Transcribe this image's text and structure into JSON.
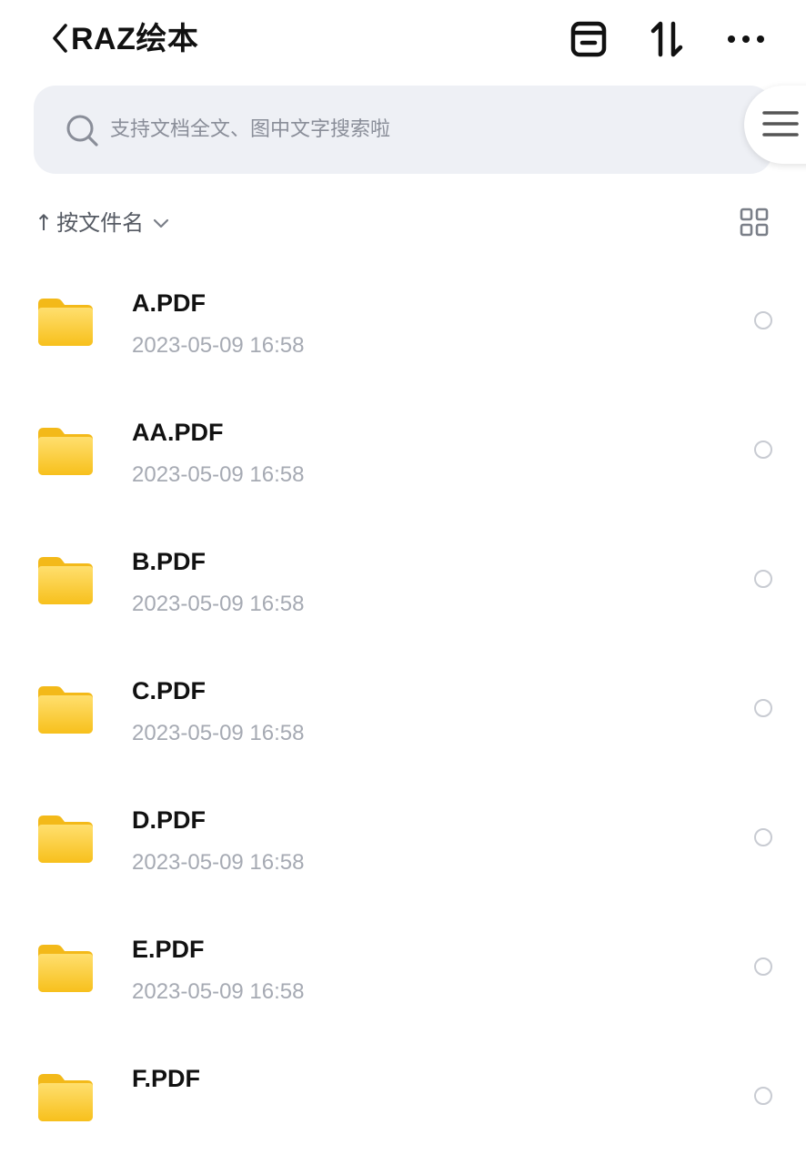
{
  "header": {
    "title": "RAZ绘本",
    "back_icon": "chevron-left-icon",
    "recent_icon": "tray-icon",
    "sort_icon": "sort-arrows-icon",
    "more_icon": "more-dots-icon"
  },
  "search": {
    "placeholder": "支持文档全文、图中文字搜索啦",
    "icon": "search-icon",
    "side_menu_icon": "hamburger-menu-icon"
  },
  "sort": {
    "arrow": "↑",
    "label": "按文件名",
    "chevron_icon": "chevron-down-icon",
    "view_toggle_icon": "grid-view-icon"
  },
  "files": [
    {
      "name": "A.PDF",
      "date": "2023-05-09 16:58",
      "icon": "folder-icon"
    },
    {
      "name": "AA.PDF",
      "date": "2023-05-09 16:58",
      "icon": "folder-icon"
    },
    {
      "name": "B.PDF",
      "date": "2023-05-09 16:58",
      "icon": "folder-icon"
    },
    {
      "name": "C.PDF",
      "date": "2023-05-09 16:58",
      "icon": "folder-icon"
    },
    {
      "name": "D.PDF",
      "date": "2023-05-09 16:58",
      "icon": "folder-icon"
    },
    {
      "name": "E.PDF",
      "date": "2023-05-09 16:58",
      "icon": "folder-icon"
    },
    {
      "name": "F.PDF",
      "date": "",
      "icon": "folder-icon"
    }
  ],
  "colors": {
    "folder_top": "#ffd95c",
    "folder_bottom": "#f8c21a",
    "search_bg": "#eef0f5",
    "secondary_text": "#a6aab3"
  }
}
